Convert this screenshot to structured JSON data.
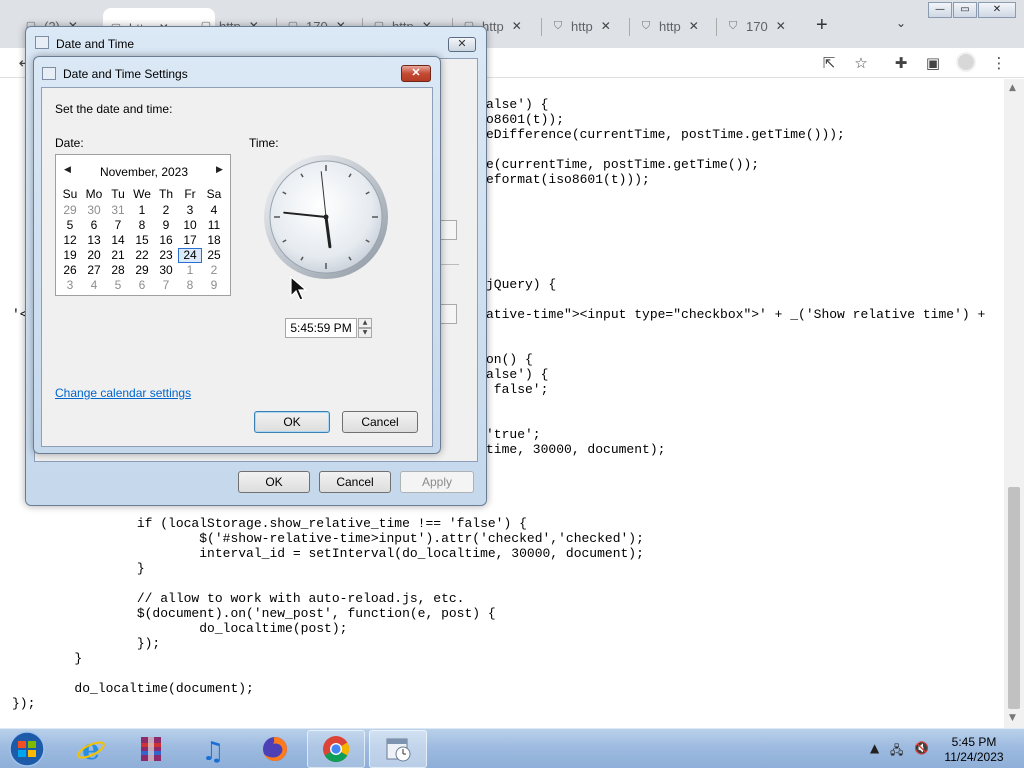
{
  "browser": {
    "tabs": [
      {
        "label": "(2)",
        "icon": "page-icon"
      },
      {
        "label": "http",
        "icon": "page-icon"
      },
      {
        "label": "http",
        "icon": "page-icon"
      },
      {
        "label": "170",
        "icon": "page-icon"
      },
      {
        "label": "http",
        "icon": "page-icon"
      },
      {
        "label": "http",
        "icon": "page-icon"
      },
      {
        "label": "http",
        "icon": "shield-icon"
      },
      {
        "label": "http",
        "icon": "shield-icon"
      },
      {
        "label": "170",
        "icon": "shield-icon"
      }
    ],
    "new_tab_label": "+",
    "toolbar_icons": [
      "back-icon",
      "share-icon",
      "star-icon",
      "extensions-icon",
      "sidepanel-icon",
      "profile-icon",
      "menu-icon"
    ]
  },
  "code": {
    "upper_lines": [
      "alse') {",
      "o8601(t));",
      "eDifference(currentTime, postTime.getTime()));",
      "",
      "e(currentTime, postTime.getTime());",
      "eformat(iso8601(t)));",
      "",
      "",
      "",
      "",
      "",
      "",
      "jQuery) {",
      "",
      "ative-time\"><input type=\"checkbox\">' + _('Show relative time') +",
      "",
      "",
      "on() {",
      "alse') {",
      " false';",
      "",
      "",
      "'true';",
      "time, 30000, document);"
    ],
    "left_fragment": "'<",
    "lower_lines": [
      "\t\tif (localStorage.show_relative_time !== 'false') {",
      "\t\t\t$('#show-relative-time>input').attr('checked','checked');",
      "\t\t\tinterval_id = setInterval(do_localtime, 30000, document);",
      "\t\t}",
      "",
      "\t\t// allow to work with auto-reload.js, etc.",
      "\t\t$(document).on('new_post', function(e, post) {",
      "\t\t\tdo_localtime(post);",
      "\t\t});",
      "\t}",
      "",
      "\tdo_localtime(document);",
      "});"
    ]
  },
  "outer_dialog": {
    "title": "Date and Time",
    "close_label": "✕",
    "ok_label": "OK",
    "cancel_label": "Cancel",
    "apply_label": "Apply"
  },
  "inner_dialog": {
    "title": "Date and Time Settings",
    "close_label": "✕",
    "prompt": "Set the date and time:",
    "date_label": "Date:",
    "time_label": "Time:",
    "calendar": {
      "month_year": "November, 2023",
      "prev": "◀",
      "next": "▶",
      "weekdays": [
        "Su",
        "Mo",
        "Tu",
        "We",
        "Th",
        "Fr",
        "Sa"
      ],
      "weeks": [
        [
          "29",
          "30",
          "31",
          "1",
          "2",
          "3",
          "4"
        ],
        [
          "5",
          "6",
          "7",
          "8",
          "9",
          "10",
          "11"
        ],
        [
          "12",
          "13",
          "14",
          "15",
          "16",
          "17",
          "18"
        ],
        [
          "19",
          "20",
          "21",
          "22",
          "23",
          "24",
          "25"
        ],
        [
          "26",
          "27",
          "28",
          "29",
          "30",
          "1",
          "2"
        ],
        [
          "3",
          "4",
          "5",
          "6",
          "7",
          "8",
          "9"
        ]
      ],
      "selected_day": "24"
    },
    "clock": {
      "hour": 5,
      "minute": 45,
      "second": 59
    },
    "time_value": "5:45:59 PM",
    "change_calendar_link": "Change calendar settings",
    "ok_label": "OK",
    "cancel_label": "Cancel"
  },
  "taskbar": {
    "apps": [
      "windows-start-icon",
      "internet-explorer-icon",
      "winrar-icon",
      "itunes-icon",
      "firefox-icon",
      "chrome-icon",
      "date-time-control-panel-icon"
    ],
    "clock_time": "5:45 PM",
    "clock_date": "11/24/2023"
  }
}
